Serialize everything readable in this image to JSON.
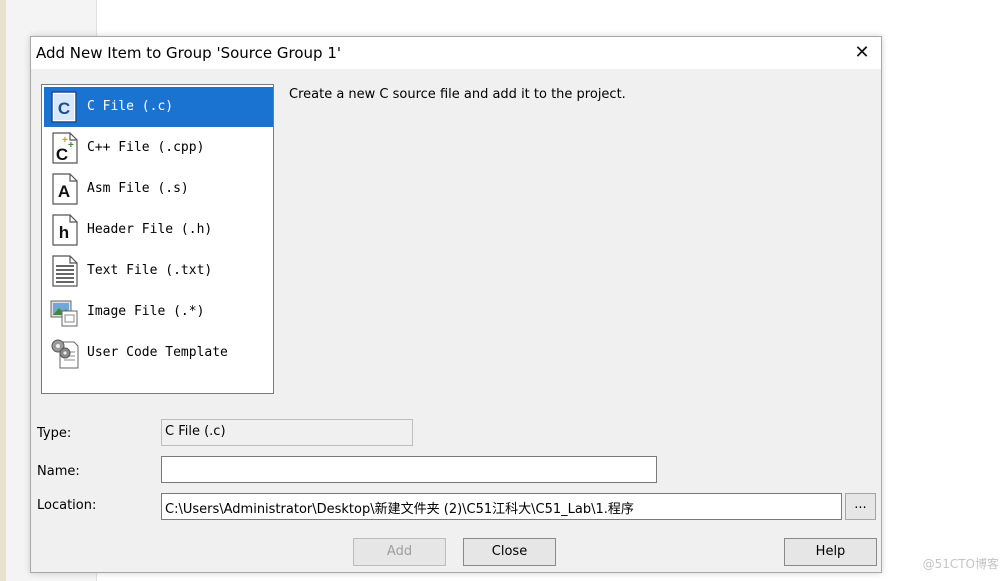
{
  "dialog": {
    "title": "Add New Item to Group 'Source Group 1'",
    "close_glyph": "✕"
  },
  "file_types": [
    {
      "label": "C File (.c)",
      "icon": "c-file-icon",
      "selected": true
    },
    {
      "label": "C++ File (.cpp)",
      "icon": "cpp-file-icon",
      "selected": false
    },
    {
      "label": "Asm File (.s)",
      "icon": "asm-file-icon",
      "selected": false
    },
    {
      "label": "Header File (.h)",
      "icon": "header-file-icon",
      "selected": false
    },
    {
      "label": "Text File (.txt)",
      "icon": "text-file-icon",
      "selected": false
    },
    {
      "label": "Image File (.*)",
      "icon": "image-file-icon",
      "selected": false
    },
    {
      "label": "User Code Template",
      "icon": "user-code-template-icon",
      "selected": false
    }
  ],
  "description": "Create a new C source file and add it to the project.",
  "form": {
    "type_label": "Type:",
    "type_value": "C File (.c)",
    "name_label": "Name:",
    "name_value": "",
    "location_label": "Location:",
    "location_value": "C:\\Users\\Administrator\\Desktop\\新建文件夹 (2)\\C51江科大\\C51_Lab\\1.程序",
    "browse_label": "..."
  },
  "buttons": {
    "add": "Add",
    "close": "Close",
    "help": "Help"
  },
  "watermark": "@51CTO博客",
  "colors": {
    "selection": "#1a73d1",
    "dialog_bg": "#f0f0f0"
  }
}
